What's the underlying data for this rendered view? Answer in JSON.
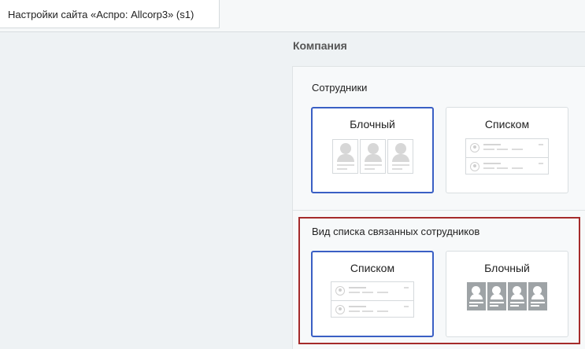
{
  "tab": {
    "title": "Настройки сайта «Аспро: Allcorp3» (s1)"
  },
  "section": {
    "title": "Компания"
  },
  "groups": [
    {
      "label": "Сотрудники",
      "options": [
        {
          "label": "Блочный",
          "selected": true
        },
        {
          "label": "Списком",
          "selected": false
        }
      ]
    },
    {
      "label": "Вид списка связанных сотрудников",
      "highlighted": true,
      "options": [
        {
          "label": "Списком",
          "selected": true
        },
        {
          "label": "Блочный",
          "selected": false
        }
      ]
    }
  ],
  "colors": {
    "selected_border": "#3a5fc4",
    "highlight_border": "#a52b2b"
  }
}
